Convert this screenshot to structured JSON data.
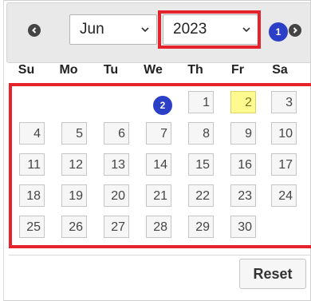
{
  "header": {
    "prev_icon": "chevron-left-icon",
    "next_icon": "chevron-right-icon",
    "month_value": "Jun",
    "year_value": "2023",
    "annotation_badge_1": "1",
    "annotation_badge_2": "2"
  },
  "weekdays": [
    "Su",
    "Mo",
    "Tu",
    "We",
    "Th",
    "Fr",
    "Sa"
  ],
  "calendar": {
    "weeks": [
      [
        "",
        "",
        "",
        "",
        "1",
        "2",
        "3"
      ],
      [
        "4",
        "5",
        "6",
        "7",
        "8",
        "9",
        "10"
      ],
      [
        "11",
        "12",
        "13",
        "14",
        "15",
        "16",
        "17"
      ],
      [
        "18",
        "19",
        "20",
        "21",
        "22",
        "23",
        "24"
      ],
      [
        "25",
        "26",
        "27",
        "28",
        "29",
        "30",
        ""
      ]
    ],
    "highlighted_day": "2"
  },
  "footer": {
    "reset_label": "Reset"
  },
  "colors": {
    "annotation_red": "#e5232d",
    "badge_blue": "#2c3fc7",
    "today_yellow": "#fffa90"
  }
}
